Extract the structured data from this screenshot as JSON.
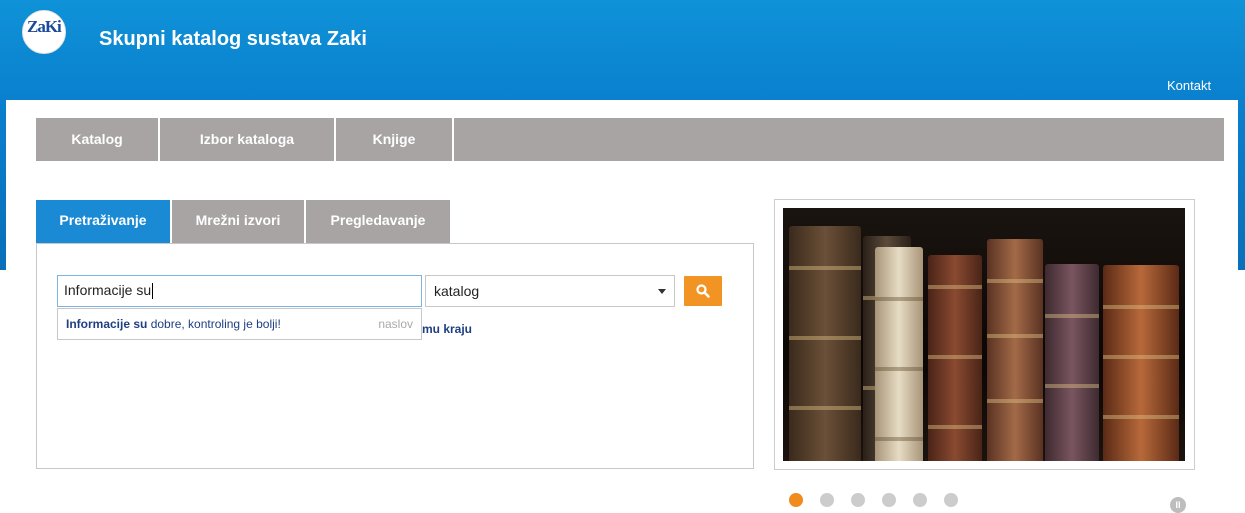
{
  "header": {
    "logo_text": "ZaKi",
    "title": "Skupni katalog sustava Zaki",
    "contact_label": "Kontakt"
  },
  "main_nav": [
    {
      "label": "Katalog"
    },
    {
      "label": "Izbor kataloga"
    },
    {
      "label": "Knjige"
    }
  ],
  "tabs": [
    {
      "label": "Pretraživanje",
      "active": true
    },
    {
      "label": "Mrežni izvori",
      "active": false
    },
    {
      "label": "Pregledavanje",
      "active": false
    }
  ],
  "search": {
    "value": "Informacije su",
    "scope_selected": "katalog",
    "button_icon": "search-icon"
  },
  "autocomplete": {
    "match": "Informacije su",
    "rest": " dobre, kontroling je bolji!",
    "type": "naslov"
  },
  "behind_text": "mu kraju",
  "slideshow": {
    "dot_count": 6,
    "active_index": 0,
    "pause_icon": "pause-icon"
  },
  "colors": {
    "header_blue": "#0a7fcd",
    "nav_gray": "#a8a4a4",
    "active_tab": "#1a8ad4",
    "accent_orange": "#f29423",
    "link_blue": "#1e3f80"
  }
}
